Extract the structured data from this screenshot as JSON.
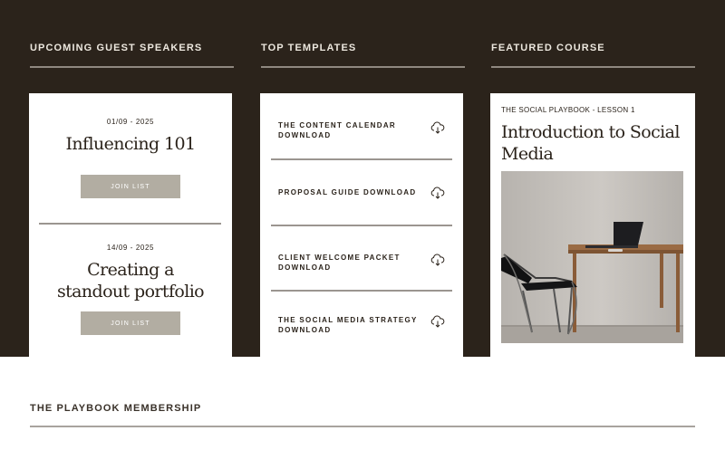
{
  "sections": {
    "speakers_heading": "UPCOMING GUEST SPEAKERS",
    "templates_heading": "TOP TEMPLATES",
    "course_heading": "FEATURED COURSE"
  },
  "speakers": [
    {
      "date": "01/09 - 2025",
      "title": "Influencing 101",
      "button": "JOIN LIST"
    },
    {
      "date": "14/09 - 2025",
      "title": "Creating a standout portfolio",
      "button": "JOIN LIST"
    }
  ],
  "templates": [
    {
      "label": "THE CONTENT CALENDAR DOWNLOAD",
      "icon": "cloud-download-icon"
    },
    {
      "label": "PROPOSAL GUIDE DOWNLOAD",
      "icon": "cloud-download-icon"
    },
    {
      "label": "CLIENT WELCOME PACKET DOWNLOAD",
      "icon": "cloud-download-icon"
    },
    {
      "label": "THE SOCIAL MEDIA STRATEGY DOWNLOAD",
      "icon": "cloud-download-icon"
    }
  ],
  "course": {
    "kicker": "THE SOCIAL PLAYBOOK - LESSON 1",
    "title": "Introduction to Social Media"
  },
  "membership": {
    "heading": "THE PLAYBOOK MEMBERSHIP"
  },
  "colors": {
    "dark_background": "#2b231b",
    "button": "#b2ada2",
    "card": "#ffffff"
  }
}
